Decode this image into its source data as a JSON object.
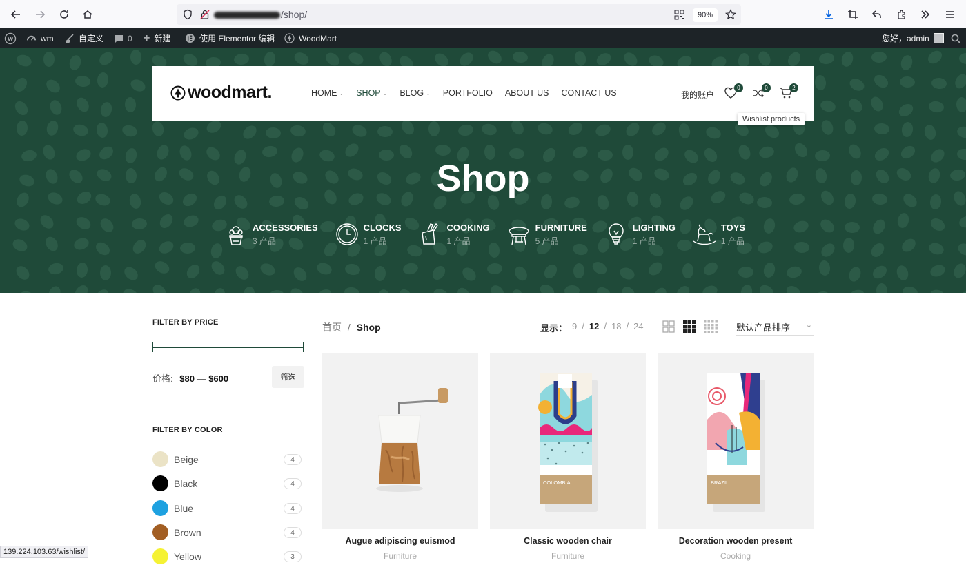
{
  "browser": {
    "url_visible": "/shop/",
    "zoom": "90%"
  },
  "adminbar": {
    "site_name": "wm",
    "customize": "自定义",
    "comments": "0",
    "new": "新建",
    "elementor": "使用 Elementor 编辑",
    "woodmart": "WoodMart",
    "greeting": "您好，admin"
  },
  "header": {
    "logo": "woodmart.",
    "nav": [
      {
        "label": "HOME",
        "dropdown": true
      },
      {
        "label": "SHOP",
        "dropdown": true
      },
      {
        "label": "BLOG",
        "dropdown": true
      },
      {
        "label": "PORTFOLIO",
        "dropdown": false
      },
      {
        "label": "ABOUT US",
        "dropdown": false
      },
      {
        "label": "CONTACT US",
        "dropdown": false
      }
    ],
    "account": "我的账户",
    "wishlist_count": "0",
    "compare_count": "0",
    "cart_count": "2",
    "tooltip": "Wishlist products"
  },
  "hero": {
    "title": "Shop",
    "categories": [
      {
        "name": "ACCESSORIES",
        "count": "3 产品",
        "icon": "cactus-icon"
      },
      {
        "name": "CLOCKS",
        "count": "1 产品",
        "icon": "clock-icon"
      },
      {
        "name": "COOKING",
        "count": "1 产品",
        "icon": "knife-block-icon"
      },
      {
        "name": "FURNITURE",
        "count": "5 产品",
        "icon": "chair-icon"
      },
      {
        "name": "LIGHTING",
        "count": "1 产品",
        "icon": "lightbulb-icon"
      },
      {
        "name": "TOYS",
        "count": "1 产品",
        "icon": "rocking-horse-icon"
      }
    ]
  },
  "sidebar": {
    "price_title": "FILTER BY PRICE",
    "price_label": "价格:",
    "price_min": "$80",
    "price_sep": "—",
    "price_max": "$600",
    "filter_button": "筛选",
    "color_title": "FILTER BY COLOR",
    "colors": [
      {
        "name": "Beige",
        "count": "4",
        "hex": "#ebe3c6"
      },
      {
        "name": "Black",
        "count": "4",
        "hex": "#000000"
      },
      {
        "name": "Blue",
        "count": "4",
        "hex": "#1ea1e0"
      },
      {
        "name": "Brown",
        "count": "4",
        "hex": "#a25e23"
      },
      {
        "name": "Yellow",
        "count": "3",
        "hex": "#f5f234"
      }
    ]
  },
  "toolbar": {
    "breadcrumb_home": "首页",
    "breadcrumb_sep": "/",
    "breadcrumb_current": "Shop",
    "per_page_label": "显示：",
    "per_page": [
      "9",
      "12",
      "18",
      "24"
    ],
    "per_page_active": "12",
    "sort": "默认产品排序"
  },
  "products": [
    {
      "name": "Augue adipiscing euismod",
      "category": "Furniture"
    },
    {
      "name": "Classic wooden chair",
      "category": "Furniture",
      "bag_label": "COLOMBIA"
    },
    {
      "name": "Decoration wooden present",
      "category": "Cooking",
      "bag_label": "BRAZIL"
    }
  ],
  "status_url": "139.224.103.63/wishlist/",
  "colors": {
    "brand_green": "#1f4a39",
    "admin_bar": "#1d2327"
  }
}
